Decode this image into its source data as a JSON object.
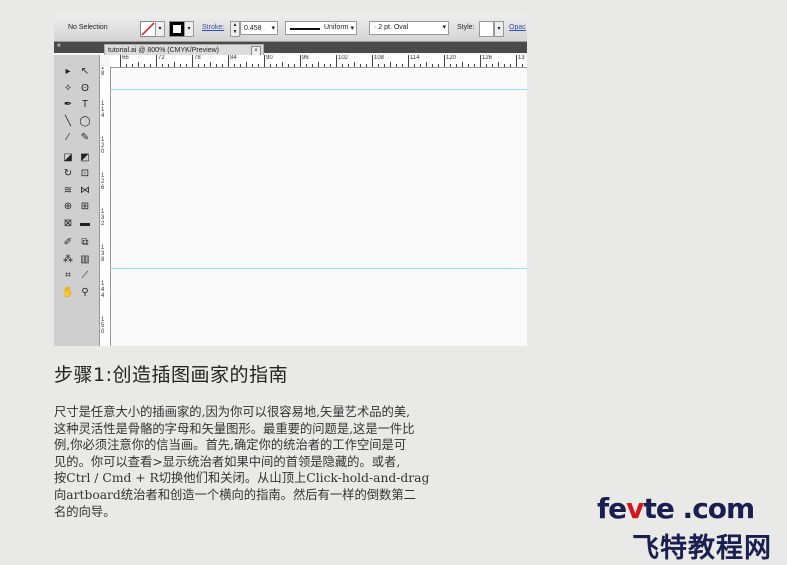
{
  "control_bar": {
    "selection": "No Selection",
    "stroke_label": "Stroke:",
    "stroke_weight": "0.458",
    "profile": "Uniform",
    "brush": "2 pt. Oval",
    "style_label": "Style:",
    "opacity_label": "Opac"
  },
  "panel_strip": {
    "collapse": "«"
  },
  "document_tab": {
    "title": "tutorial.ai @ 800% (CMYK/Preview)",
    "close": "×"
  },
  "ruler": {
    "h_numbers": [
      "66",
      "72",
      "78",
      "84",
      "90",
      "96",
      "102",
      "108",
      "114",
      "120",
      "126",
      "13"
    ],
    "v_numbers": [
      "1\n8",
      "1\n1\n4",
      "1\n2\n0",
      "1\n2\n6",
      "1\n3\n2",
      "1\n3\n8",
      "1\n4\n4",
      "1\n5\n0"
    ]
  },
  "tools": [
    {
      "icon": "selection-tool-icon",
      "glyph": "▸"
    },
    {
      "icon": "direct-selection-tool-icon",
      "glyph": "↖"
    },
    {
      "icon": "magic-wand-tool-icon",
      "glyph": "✧"
    },
    {
      "icon": "lasso-tool-icon",
      "glyph": "ʘ"
    },
    {
      "icon": "pen-tool-icon",
      "glyph": "✒"
    },
    {
      "icon": "type-tool-icon",
      "glyph": "T"
    },
    {
      "icon": "line-tool-icon",
      "glyph": "╲"
    },
    {
      "icon": "ellipse-tool-icon",
      "glyph": "◯"
    },
    {
      "icon": "paintbrush-tool-icon",
      "glyph": "∕"
    },
    {
      "icon": "pencil-tool-icon",
      "glyph": "✎"
    },
    {
      "icon": "blob-brush-tool-icon",
      "glyph": "◪"
    },
    {
      "icon": "eraser-tool-icon",
      "glyph": "◩"
    },
    {
      "icon": "rotate-tool-icon",
      "glyph": "↻"
    },
    {
      "icon": "scale-tool-icon",
      "glyph": "⊡"
    },
    {
      "icon": "warp-tool-icon",
      "glyph": "≋"
    },
    {
      "icon": "free-transform-tool-icon",
      "glyph": "⋈"
    },
    {
      "icon": "shape-builder-tool-icon",
      "glyph": "⊕"
    },
    {
      "icon": "perspective-grid-tool-icon",
      "glyph": "⊞"
    },
    {
      "icon": "mesh-tool-icon",
      "glyph": "⊠"
    },
    {
      "icon": "gradient-tool-icon",
      "glyph": "▬"
    },
    {
      "icon": "eyedropper-tool-icon",
      "glyph": "✐"
    },
    {
      "icon": "blend-tool-icon",
      "glyph": "⧉"
    },
    {
      "icon": "symbol-sprayer-tool-icon",
      "glyph": "⁂"
    },
    {
      "icon": "column-graph-tool-icon",
      "glyph": "▥"
    },
    {
      "icon": "artboard-tool-icon",
      "glyph": "⌗"
    },
    {
      "icon": "slice-tool-icon",
      "glyph": "⟋"
    },
    {
      "icon": "hand-tool-icon",
      "glyph": "✋"
    },
    {
      "icon": "zoom-tool-icon",
      "glyph": "⚲"
    }
  ],
  "article": {
    "heading": "步骤1:创造插图画家的指南",
    "lines": [
      "尺寸是任意大小的插画家的,因为你可以很容易地,矢量艺术品的美,",
      "这种灵活性是骨骼的字母和矢量图形。最重要的问题是,这是一件比",
      "例,你必须注意你的信当画。首先,确定你的统治者的工作空间是可",
      "见的。你可以查看>显示统治者如果中间的首领是隐藏的。或者,",
      "按Ctrl / Cmd + R切换他们和关闭。从山顶上Click-hold-and-drag",
      "向artboard统治者和创造一个横向的指南。然后有一样的倒数第二",
      "名的向导。"
    ]
  },
  "logo": {
    "part1": "fe",
    "part2": "v",
    "part3": "te",
    "part4": " .com",
    "cn": "飞特教程网"
  },
  "colors": {
    "accent_red": "#d8151e",
    "logo_navy": "#1a1f4f",
    "guide_cyan": "#8fe3ef"
  }
}
